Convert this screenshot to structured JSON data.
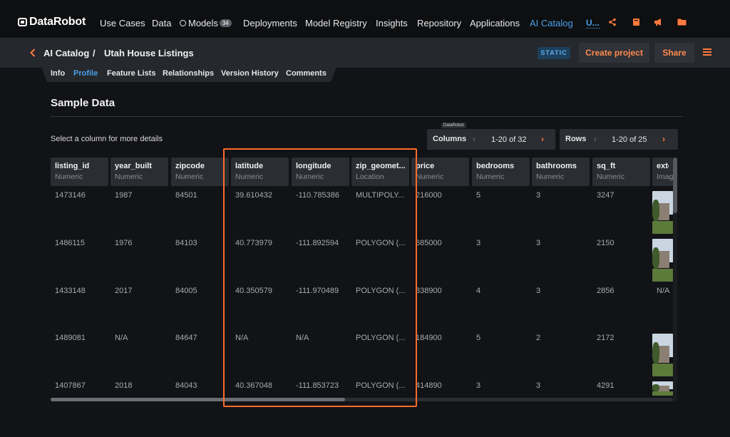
{
  "app": {
    "brand": "DataRobot"
  },
  "nav": {
    "items": [
      "Use Cases",
      "Data",
      "Models",
      "Deployments",
      "Model Registry",
      "Insights",
      "Repository",
      "Applications",
      "AI Catalog"
    ],
    "models_count": "34",
    "user_initial": "U..."
  },
  "breadcrumb": {
    "parent": "AI Catalog",
    "separator": "/",
    "current": "Utah House Listings"
  },
  "header_actions": {
    "static_badge": "STATIC",
    "create_project": "Create project",
    "share": "Share"
  },
  "tabs": [
    "Info",
    "Profile",
    "Feature Lists",
    "Relationships",
    "Version History",
    "Comments"
  ],
  "active_tab": "Profile",
  "section": {
    "title": "Sample Data",
    "hint": "Select a column for more details",
    "tooltip": "DataRobot"
  },
  "pager": {
    "columns_label": "Columns",
    "columns_range": "1-20 of 32",
    "rows_label": "Rows",
    "rows_range": "1-20 of 25"
  },
  "columns": [
    {
      "name": "listing_id",
      "type": "Numeric"
    },
    {
      "name": "year_built",
      "type": "Numeric"
    },
    {
      "name": "zipcode",
      "type": "Numeric"
    },
    {
      "name": "latitude",
      "type": "Numeric"
    },
    {
      "name": "longitude",
      "type": "Numeric"
    },
    {
      "name": "zip_geomet...",
      "type": "Location"
    },
    {
      "name": "price",
      "type": "Numeric"
    },
    {
      "name": "bedrooms",
      "type": "Numeric"
    },
    {
      "name": "bathrooms",
      "type": "Numeric"
    },
    {
      "name": "sq_ft",
      "type": "Numeric"
    },
    {
      "name": "exte",
      "type": "Imag"
    }
  ],
  "rows": [
    [
      "1473146",
      "1987",
      "84501",
      "39.610432",
      "-110.785386",
      "MULTIPOLY...",
      "216000",
      "5",
      "3",
      "3247",
      "image"
    ],
    [
      "1486115",
      "1976",
      "84103",
      "40.773979",
      "-111.892594",
      "POLYGON (...",
      "685000",
      "3",
      "3",
      "2150",
      "image"
    ],
    [
      "1433148",
      "2017",
      "84005",
      "40.350579",
      "-111.970489",
      "POLYGON (...",
      "338900",
      "4",
      "3",
      "2856",
      "N/A"
    ],
    [
      "1489081",
      "N/A",
      "84647",
      "N/A",
      "N/A",
      "POLYGON (...",
      "184900",
      "5",
      "2",
      "2172",
      "image"
    ],
    [
      "1407867",
      "2018",
      "84043",
      "40.367048",
      "-111.853723",
      "POLYGON (...",
      "414890",
      "3",
      "3",
      "4291",
      "image"
    ]
  ],
  "colors": {
    "accent_orange": "#ff6b2c",
    "accent_blue": "#4b9fe8",
    "background": "#121316"
  },
  "icons": [
    "share-icon",
    "book-icon",
    "megaphone-icon",
    "folder-icon",
    "chevron-left-icon",
    "chevron-right-icon",
    "menu-icon"
  ]
}
